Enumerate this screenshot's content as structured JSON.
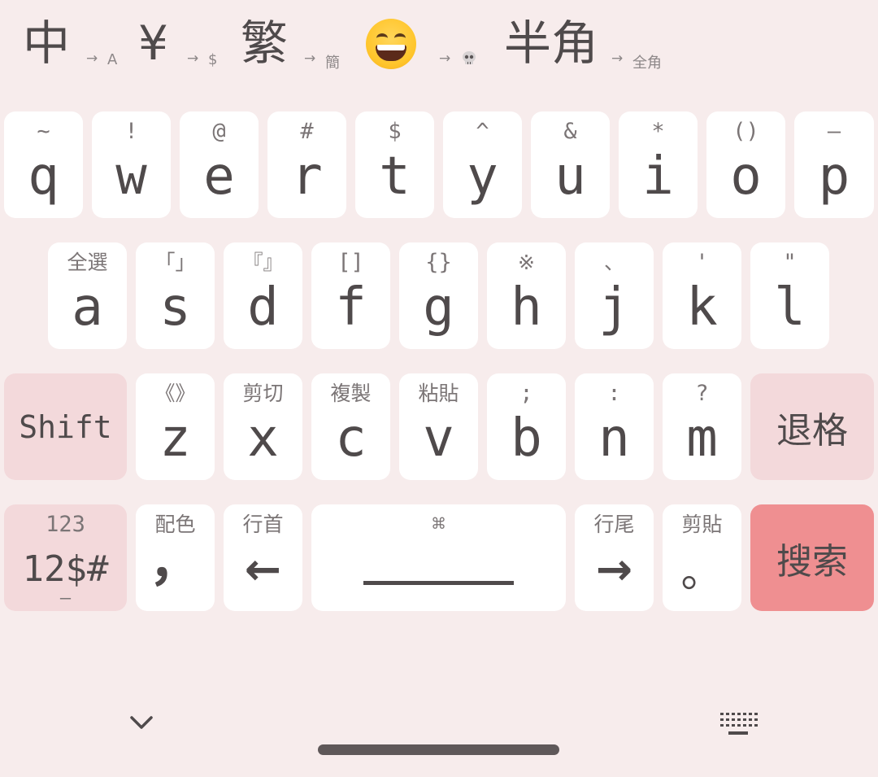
{
  "toolbar": {
    "items": [
      {
        "name": "chinese-mode",
        "main": "中",
        "arrow": "→",
        "sub": "A"
      },
      {
        "name": "yen",
        "main": "¥",
        "arrow": "→",
        "sub": "$"
      },
      {
        "name": "traditional",
        "main": "繁",
        "arrow": "→",
        "sub": "簡"
      },
      {
        "name": "emoji",
        "main": "grinning-face-emoji",
        "arrow": "→",
        "sub": "skull-emoji"
      },
      {
        "name": "halfwidth",
        "main": "半角",
        "arrow": "→",
        "sub": "全角"
      }
    ]
  },
  "rows": {
    "row1": [
      {
        "hint": "~",
        "main": "q"
      },
      {
        "hint": "!",
        "main": "w"
      },
      {
        "hint": "@",
        "main": "e"
      },
      {
        "hint": "#",
        "main": "r"
      },
      {
        "hint": "$",
        "main": "t"
      },
      {
        "hint": "^",
        "main": "y"
      },
      {
        "hint": "&",
        "main": "u"
      },
      {
        "hint": "*",
        "main": "i"
      },
      {
        "hint": "()",
        "main": "o"
      },
      {
        "hint": "—",
        "main": "p"
      }
    ],
    "row2": [
      {
        "hint": "全選",
        "main": "a"
      },
      {
        "hint": "「」",
        "main": "s"
      },
      {
        "hint": "『』",
        "main": "d"
      },
      {
        "hint": "[]",
        "main": "f"
      },
      {
        "hint": "{}",
        "main": "g"
      },
      {
        "hint": "※",
        "main": "h"
      },
      {
        "hint": "、",
        "main": "j"
      },
      {
        "hint": "'",
        "main": "k"
      },
      {
        "hint": "\"",
        "main": "l"
      }
    ],
    "row3": {
      "shift": "Shift",
      "keys": [
        {
          "hint": "《》",
          "main": "z"
        },
        {
          "hint": "剪切",
          "main": "x"
        },
        {
          "hint": "複製",
          "main": "c"
        },
        {
          "hint": "粘貼",
          "main": "v"
        },
        {
          "hint": ";",
          "main": "b"
        },
        {
          "hint": ":",
          "main": "n"
        },
        {
          "hint": "?",
          "main": "m"
        }
      ],
      "backspace": "退格"
    },
    "row4": {
      "numbers": {
        "hint": "123",
        "main": "12$#",
        "foot": "—"
      },
      "comma": {
        "hint": "配色",
        "main": "，"
      },
      "line_start": {
        "hint": "行首",
        "main": "←"
      },
      "space": {
        "hint": "⌘"
      },
      "line_end": {
        "hint": "行尾",
        "main": "→"
      },
      "period": {
        "hint": "剪貼",
        "main": "。"
      },
      "search": "搜索"
    }
  },
  "colors": {
    "background": "#f7ecec",
    "key": "#ffffff",
    "function_key": "#f3d9db",
    "action_key": "#ef8f91",
    "text": "#4f4a4b"
  },
  "nav": {
    "hide_icon": "chevron-down-icon",
    "keyboard_icon": "keyboard-icon"
  }
}
